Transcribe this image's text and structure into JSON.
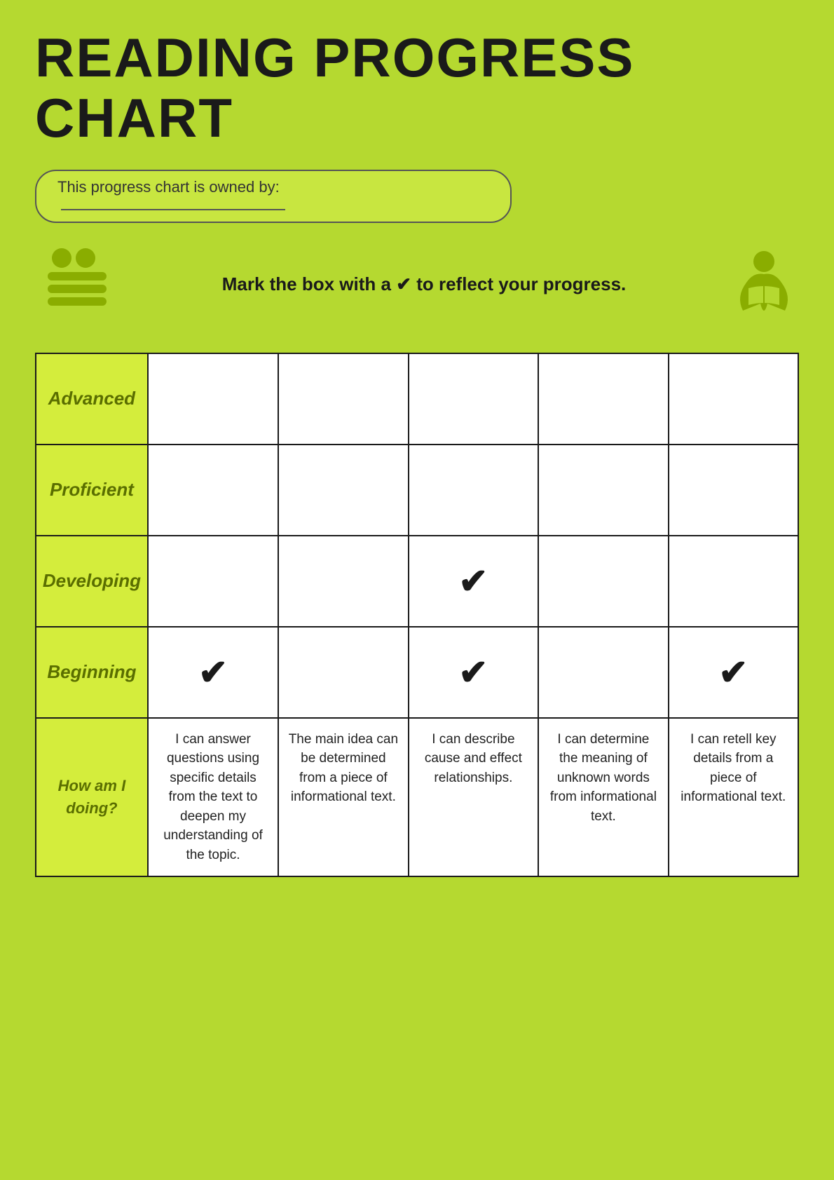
{
  "title": "READING PROGRESS CHART",
  "owner_label": "This progress chart is owned by:",
  "instruction": "Mark the box with a ✔ to reflect your progress.",
  "rows": [
    {
      "id": "advanced",
      "label": "Advanced",
      "checks": [
        false,
        false,
        false,
        false,
        false
      ]
    },
    {
      "id": "proficient",
      "label": "Proficient",
      "checks": [
        false,
        false,
        false,
        false,
        false
      ]
    },
    {
      "id": "developing",
      "label": "Developing",
      "checks": [
        false,
        false,
        true,
        false,
        false
      ]
    },
    {
      "id": "beginning",
      "label": "Beginning",
      "checks": [
        true,
        false,
        true,
        false,
        true
      ]
    }
  ],
  "how_am_i_label": "How am I doing?",
  "descriptions": [
    "I can answer questions using specific details from the text to deepen my understanding of the topic.",
    "The main idea can be determined from a piece of informational text.",
    "I can describe cause and effect relationships.",
    "I can determine the meaning of unknown words from informational text.",
    "I can retell key details from a piece of informational text."
  ]
}
